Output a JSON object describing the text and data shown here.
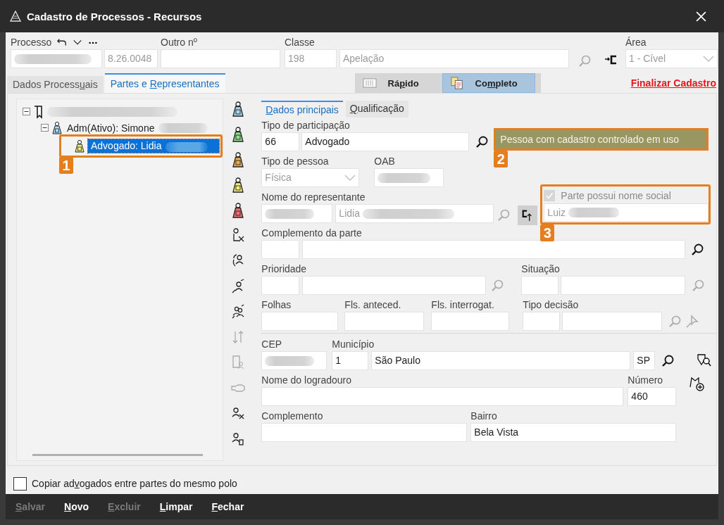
{
  "window": {
    "title": "Cadastro de Processos - Recursos"
  },
  "header": {
    "processo": {
      "label": "Processo",
      "suffix": "8.26.0048"
    },
    "outro": {
      "label": "Outro nº"
    },
    "classe": {
      "label": "Classe",
      "code": "198",
      "name": "Apelação",
      "disabled": true
    },
    "area": {
      "label": "Área",
      "value": "1 - Cível",
      "disabled": true
    }
  },
  "tabs": [
    {
      "label": "Dados Processuais",
      "selected": false
    },
    {
      "label": "Partes e Representantes",
      "selected": true
    }
  ],
  "view_buttons": [
    {
      "label": "Rápido",
      "selected": false
    },
    {
      "label": "Completo",
      "selected": true
    }
  ],
  "finalize_link": "Finalizar Cadastro",
  "tree": [
    {
      "kind": "process",
      "redacted": true,
      "expanded": true,
      "selected": false,
      "children": [
        {
          "kind": "party",
          "label": "Adm(Ativo): Simone",
          "redacted": true,
          "expanded": true,
          "selected": false,
          "children": [
            {
              "kind": "lawyer",
              "label": "Advogado: Lidia",
              "redacted": true,
              "selected": true
            }
          ]
        }
      ]
    }
  ],
  "sub_tabs": [
    {
      "label": "Dados principais",
      "selected": true
    },
    {
      "label": "Qualificação",
      "selected": false
    }
  ],
  "form": {
    "participacao": {
      "label": "Tipo de participação",
      "code": "66",
      "name": "Advogado"
    },
    "status_badge": "Pessoa com cadastro controlado em uso",
    "tipo_pessoa": {
      "label": "Tipo de pessoa",
      "value": "Física",
      "disabled": true
    },
    "oab": {
      "label": "OAB"
    },
    "representante": {
      "label": "Nome do representante",
      "name": "Lidia",
      "disabled": true
    },
    "nome_social": {
      "label": "Parte possui nome social",
      "checked": true,
      "disabled": true,
      "value": "Luiz"
    },
    "complemento_parte": {
      "label": "Complemento da parte"
    },
    "prioridade": {
      "label": "Prioridade"
    },
    "situacao": {
      "label": "Situação"
    },
    "folhas": {
      "label": "Folhas"
    },
    "fls_anteced": {
      "label": "Fls. anteced."
    },
    "fls_interrogat": {
      "label": "Fls. interrogat."
    },
    "tipo_decisao": {
      "label": "Tipo decisão"
    },
    "cep": {
      "label": "CEP"
    },
    "municipio": {
      "label": "Município",
      "code": "1",
      "name": "São Paulo",
      "uf": "SP"
    },
    "logradouro": {
      "label": "Nome do logradouro"
    },
    "numero": {
      "label": "Número",
      "value": "460"
    },
    "complemento": {
      "label": "Complemento"
    },
    "bairro": {
      "label": "Bairro",
      "value": "Bela Vista"
    }
  },
  "copy_checkbox": {
    "label": "Copiar advogados entre partes do mesmo polo",
    "checked": false
  },
  "footer_buttons": [
    {
      "label": "Salvar",
      "disabled": true
    },
    {
      "label": "Novo",
      "disabled": false
    },
    {
      "label": "Excluir",
      "disabled": true
    },
    {
      "label": "Limpar",
      "disabled": false
    },
    {
      "label": "Fechar",
      "disabled": false
    }
  ],
  "callouts": [
    "1",
    "2",
    "3"
  ]
}
